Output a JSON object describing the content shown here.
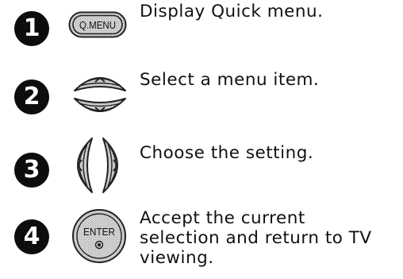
{
  "steps": [
    {
      "number": "1",
      "button": {
        "label": "Q.MENU"
      },
      "text": "Display Quick menu."
    },
    {
      "number": "2",
      "button": {
        "icons": [
          "up-arrow",
          "down-arrow"
        ]
      },
      "text": "Select a menu item."
    },
    {
      "number": "3",
      "button": {
        "icons": [
          "left-arrow",
          "right-arrow"
        ]
      },
      "text": "Choose the setting."
    },
    {
      "number": "4",
      "button": {
        "label": "ENTER"
      },
      "text_lines": [
        "Accept the current",
        "selection and return to TV",
        "viewing."
      ]
    }
  ],
  "colors": {
    "badge": "#0d0d0d",
    "button_fill": "#d9d9d9",
    "button_stroke": "#222222"
  }
}
